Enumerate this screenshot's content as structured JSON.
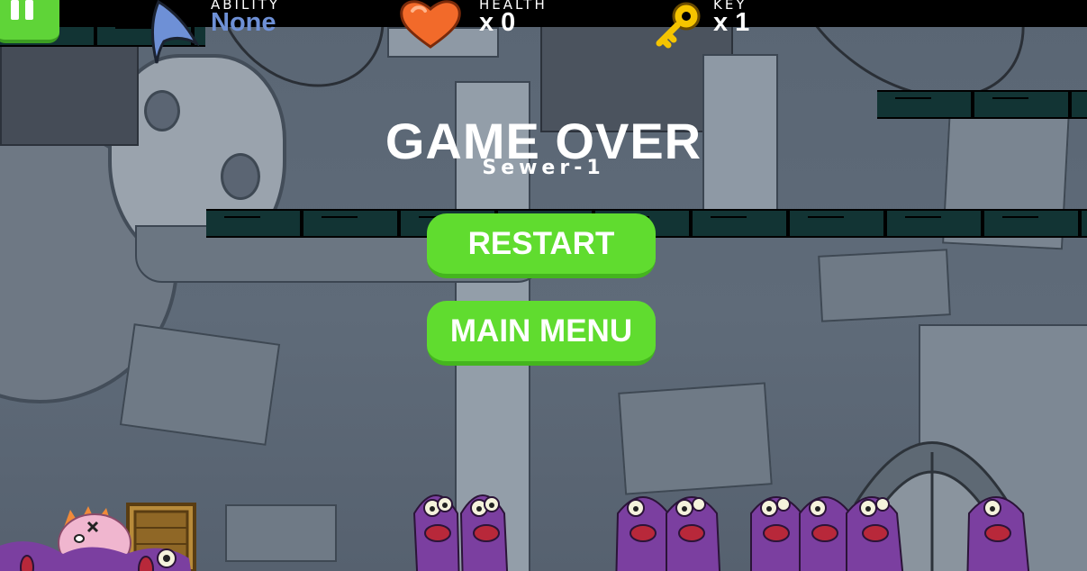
{
  "hud": {
    "ability_label": "ABILITY",
    "ability_value": "None",
    "health_label": "HEALTH",
    "health_value": "x 0",
    "key_label": "KEY",
    "key_value": "x 1",
    "icons": [
      "pause-icon",
      "shark-fin-icon",
      "heart-icon",
      "key-icon"
    ]
  },
  "overlay": {
    "title": "GAME OVER",
    "level": "Sewer-1",
    "restart_label": "RESTART",
    "main_menu_label": "MAIN MENU"
  },
  "colors": {
    "button_green": "#60dc2f",
    "ability_blue": "#6e90d6",
    "hud_bar": "#000000",
    "monster_purple": "#7b3fa0"
  }
}
